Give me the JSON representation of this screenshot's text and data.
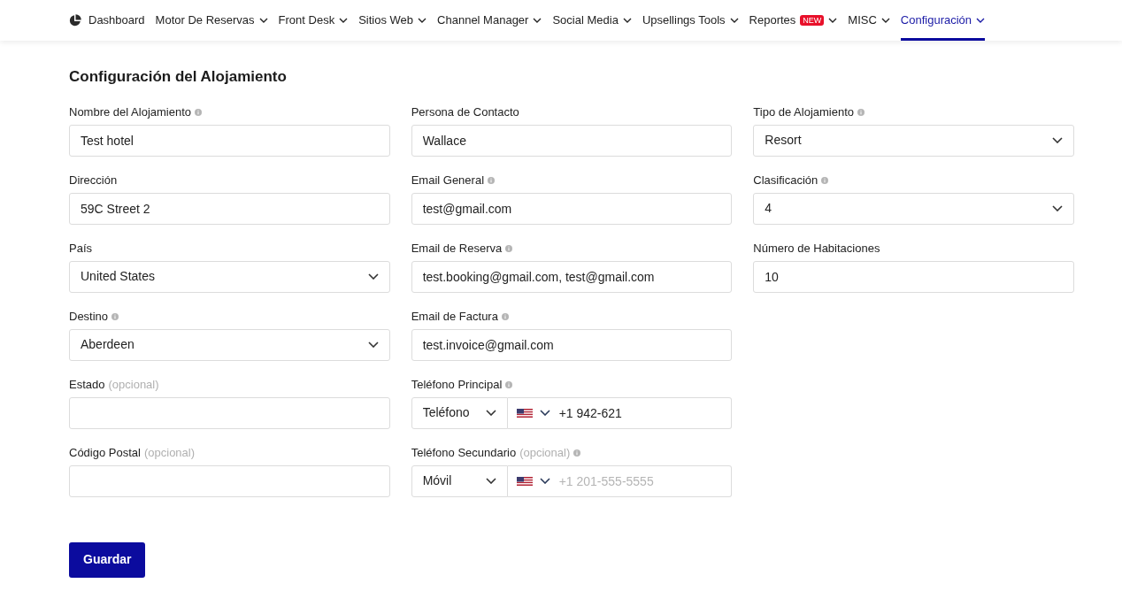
{
  "nav": [
    {
      "label": "Dashboard",
      "kind": "dashboard",
      "dropdown": false,
      "selected": false
    },
    {
      "label": "Motor De Reservas",
      "dropdown": true,
      "selected": false
    },
    {
      "label": "Front Desk",
      "dropdown": true,
      "selected": false
    },
    {
      "label": "Sitios Web",
      "dropdown": true,
      "selected": false
    },
    {
      "label": "Channel Manager",
      "dropdown": true,
      "selected": false
    },
    {
      "label": "Social Media",
      "dropdown": true,
      "selected": false
    },
    {
      "label": "Upsellings Tools",
      "dropdown": true,
      "selected": false
    },
    {
      "label": "Reportes",
      "badge": "NEW",
      "dropdown": true,
      "selected": false
    },
    {
      "label": "MISC",
      "dropdown": true,
      "selected": false
    },
    {
      "label": "Configuración",
      "dropdown": true,
      "selected": true
    }
  ],
  "title": "Configuración del Alojamiento",
  "columns": [
    [
      {
        "label": "Nombre del Alojamiento",
        "info": true,
        "kind": "text",
        "value": "Test hotel"
      },
      {
        "label": "Dirección",
        "info": false,
        "kind": "text",
        "value": "59C Street 2"
      },
      {
        "label": "País",
        "info": false,
        "kind": "select",
        "value": "United States"
      },
      {
        "label": "Destino",
        "info": true,
        "kind": "select",
        "value": "Aberdeen"
      },
      {
        "label": "Estado",
        "note": "(opcional)",
        "info": false,
        "kind": "text"
      },
      {
        "label": "Código Postal",
        "note": "(opcional)",
        "info": false,
        "kind": "text"
      }
    ],
    [
      {
        "label": "Persona de Contacto",
        "info": false,
        "kind": "text",
        "value": "Wallace"
      },
      {
        "label": "Email General",
        "info": true,
        "kind": "text",
        "value": "test@gmail.com"
      },
      {
        "label": "Email de Reserva",
        "info": true,
        "kind": "text",
        "value": "test.booking@gmail.com, test@gmail.com"
      },
      {
        "label": "Email de Factura",
        "info": true,
        "kind": "text",
        "value": "test.invoice@gmail.com"
      },
      {
        "label": "Teléfono Principal",
        "info": true,
        "kind": "phone",
        "phone_type": "Teléfono",
        "value": "+1 942-621"
      },
      {
        "label": "Teléfono Secundario",
        "note": "(opcional)",
        "info": true,
        "kind": "phone",
        "phone_type": "Móvil",
        "placeholder": "+1 201-555-5555"
      }
    ],
    [
      {
        "label": "Tipo de Alojamiento",
        "info": true,
        "kind": "select",
        "value": "Resort"
      },
      {
        "label": "Clasificación",
        "info": true,
        "kind": "select",
        "value": "4"
      },
      {
        "label": "Número de Habitaciones",
        "info": false,
        "kind": "text",
        "value": "10"
      }
    ]
  ],
  "save_button": "Guardar"
}
